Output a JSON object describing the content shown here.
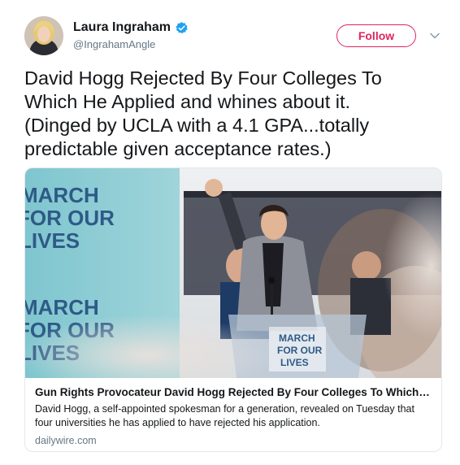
{
  "author": {
    "display_name": "Laura Ingraham",
    "handle": "@IngrahamAngle",
    "verified": true,
    "avatar_icon": "avatar-photo"
  },
  "actions": {
    "follow_label": "Follow",
    "menu_icon": "chevron-down-icon"
  },
  "tweet": {
    "text": "David Hogg Rejected By Four Colleges To\nWhich He Applied and whines about it.\n(Dinged by UCLA with a 4.1 GPA...totally\npredictable given acceptance rates.)"
  },
  "card": {
    "image": {
      "sign_lines": [
        "MARCH",
        "FOR OUR",
        "LIVES"
      ],
      "podium_lines": [
        "MARCH",
        "FOR OUR",
        "LIVES"
      ]
    },
    "title": "Gun Rights Provocateur David Hogg Rejected By Four Colleges To Which He ...",
    "description": "David Hogg, a self-appointed spokesman for a generation, revealed on Tuesday that four universities he has applied to have rejected his application.",
    "domain": "dailywire.com"
  },
  "colors": {
    "text": "#14171a",
    "secondary": "#657786",
    "follow": "#e0245e",
    "verified": "#1da1f2",
    "border": "#e1e8ed"
  }
}
